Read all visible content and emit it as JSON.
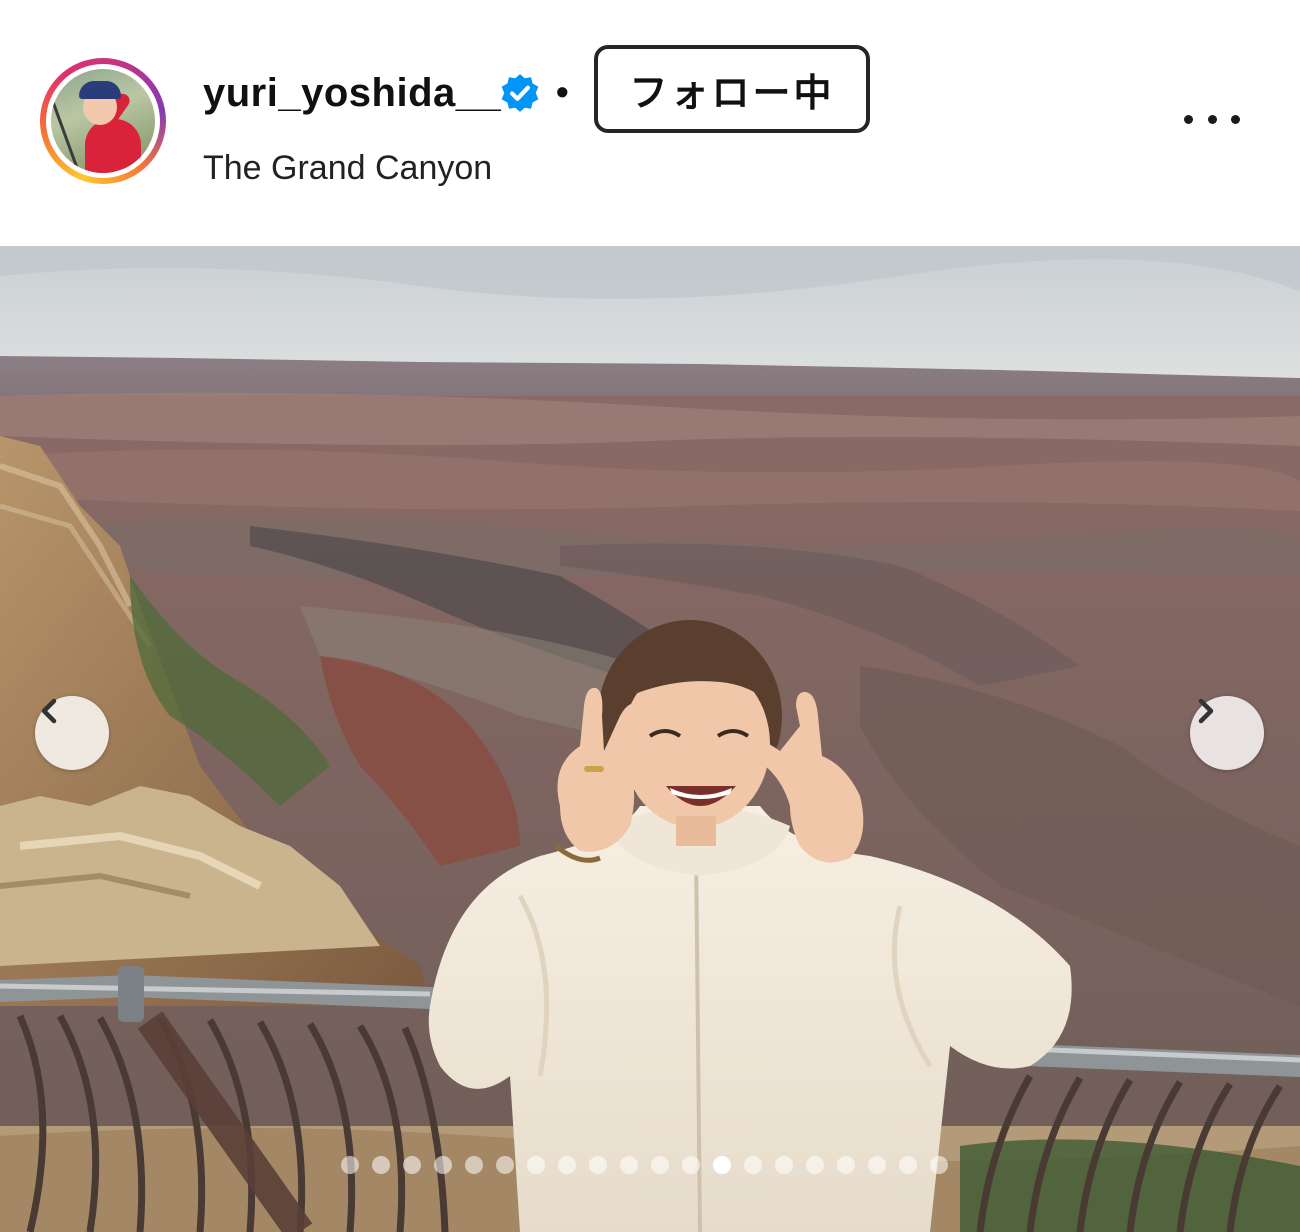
{
  "post_header": {
    "username": "yuri_yoshida__",
    "verified": true,
    "separator": "•",
    "follow_button_label": "フォロー中",
    "location": "The Grand Canyon",
    "more_icon": "more-horizontal-icon"
  },
  "carousel": {
    "prev_icon": "chevron-left-icon",
    "next_icon": "chevron-right-icon",
    "slide_count": 20,
    "active_slide": 13
  },
  "colors": {
    "verified_blue": "#0095f6",
    "story_ring": [
      "#fdc830",
      "#f37335",
      "#e1306c",
      "#833ab4"
    ]
  }
}
